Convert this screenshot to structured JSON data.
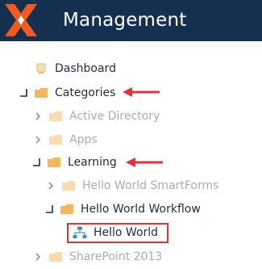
{
  "header": {
    "title": "Management",
    "logo_colors": [
      "#f15a22",
      "#ffffff"
    ],
    "background": "#15304f"
  },
  "tree": {
    "nodes": [
      {
        "label": "Dashboard",
        "icon": "dashboard-icon",
        "expander": "none",
        "style": "dark"
      },
      {
        "label": "Categories",
        "icon": "folder-icon",
        "expander": "expanded",
        "style": "dark",
        "arrow": true
      },
      {
        "label": "Active Directory",
        "icon": "folder-icon",
        "expander": "collapsed",
        "style": "muted"
      },
      {
        "label": "Apps",
        "icon": "folder-icon",
        "expander": "collapsed",
        "style": "muted"
      },
      {
        "label": "Learning",
        "icon": "folder-icon",
        "expander": "expanded",
        "style": "dark",
        "arrow": true
      },
      {
        "label": "Hello World SmartForms",
        "icon": "folder-icon",
        "expander": "collapsed",
        "style": "muted"
      },
      {
        "label": "Hello World Workflow",
        "icon": "folder-icon",
        "expander": "expanded",
        "style": "dark"
      },
      {
        "label": "Hello World",
        "icon": "workflow-icon",
        "expander": "none",
        "style": "dark",
        "highlighted": true
      },
      {
        "label": "SharePoint 2013",
        "icon": "folder-icon",
        "expander": "collapsed",
        "style": "muted"
      }
    ]
  },
  "colors": {
    "folder_dark": "#f3b75e",
    "folder_muted": "#f8dcb0",
    "annotation_red": "#e2333a",
    "text_dark": "#1f2d3d",
    "text_muted": "#a7adb4",
    "workflow_blue": "#3a8fd1"
  }
}
